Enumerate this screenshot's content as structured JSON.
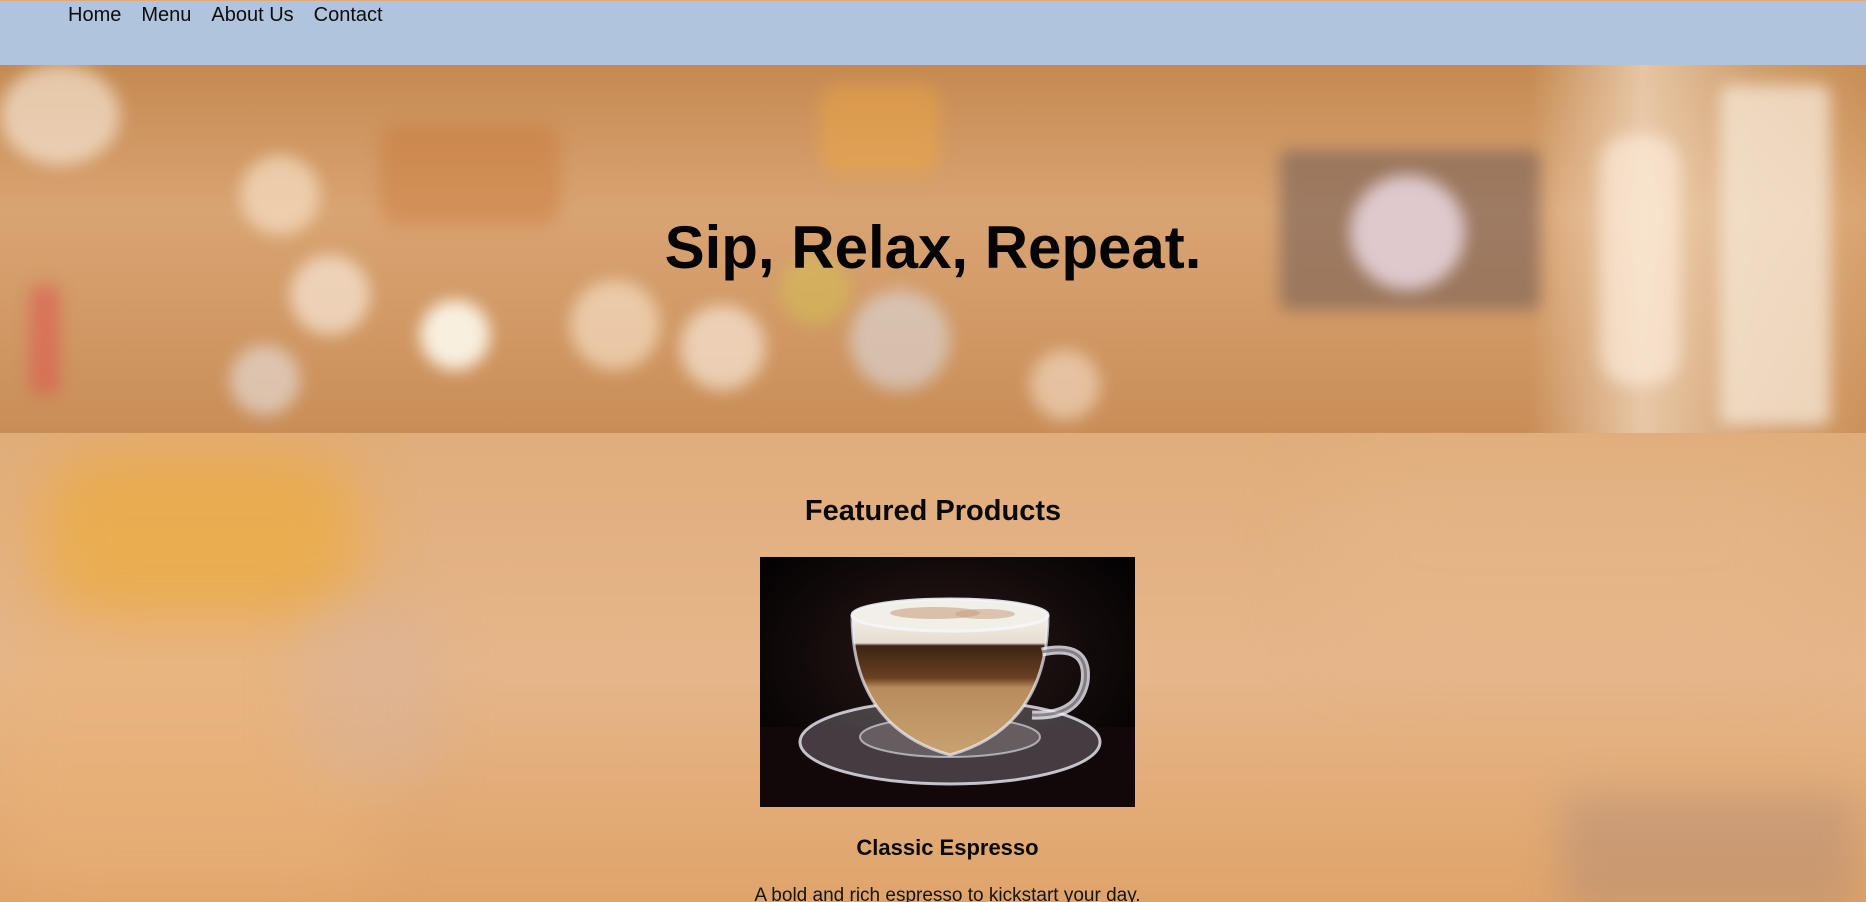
{
  "nav": {
    "items": [
      {
        "label": "Home"
      },
      {
        "label": "Menu"
      },
      {
        "label": "About Us"
      },
      {
        "label": "Contact"
      }
    ],
    "background": "#b0c4de"
  },
  "hero": {
    "title": "Sip, Relax, Repeat."
  },
  "featured": {
    "heading": "Featured Products",
    "products": [
      {
        "name": "Classic Espresso",
        "description": "A bold and rich espresso to kickstart your day.",
        "image_icon": "layered-coffee-cup-image"
      }
    ]
  },
  "colors": {
    "accent_warm": "#e0ad7b",
    "text": "#0a0a0a"
  }
}
